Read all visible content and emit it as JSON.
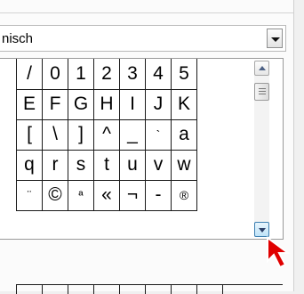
{
  "font_select": {
    "value": "nisch"
  },
  "characters": [
    [
      "/",
      "0",
      "1",
      "2",
      "3",
      "4",
      "5"
    ],
    [
      "E",
      "F",
      "G",
      "H",
      "I",
      "J",
      "K"
    ],
    [
      "[",
      "\\",
      "]",
      "^",
      "_",
      "`",
      "a"
    ],
    [
      "q",
      "r",
      "s",
      "t",
      "u",
      "v",
      "w"
    ],
    [
      "¨",
      "©",
      "ª",
      "«",
      "¬",
      "-",
      "®"
    ]
  ],
  "colors": {
    "cursor": "#e00000",
    "scroll_hover": "#bfe3f8"
  },
  "icons": {
    "dropdown": "chevron-down-icon",
    "scroll_up": "arrow-up-icon",
    "scroll_down": "arrow-down-icon",
    "pointer": "mouse-pointer-icon"
  }
}
